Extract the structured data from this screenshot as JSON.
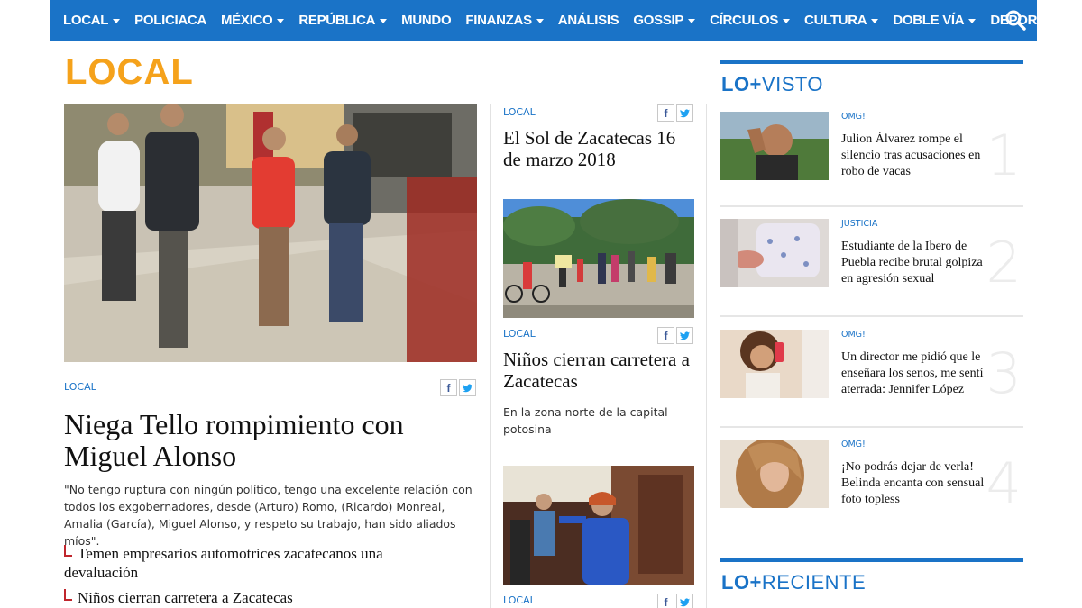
{
  "nav": {
    "items": [
      {
        "label": "LOCAL",
        "dropdown": true
      },
      {
        "label": "POLICIACA",
        "dropdown": false
      },
      {
        "label": "MÉXICO",
        "dropdown": true
      },
      {
        "label": "REPÚBLICA",
        "dropdown": true
      },
      {
        "label": "MUNDO",
        "dropdown": false
      },
      {
        "label": "FINANZAS",
        "dropdown": true
      },
      {
        "label": "ANÁLISIS",
        "dropdown": false
      },
      {
        "label": "GOSSIP",
        "dropdown": true
      },
      {
        "label": "CÍRCULOS",
        "dropdown": true
      },
      {
        "label": "CULTURA",
        "dropdown": true
      },
      {
        "label": "DOBLE VÍA",
        "dropdown": true
      },
      {
        "label": "DEPORTES",
        "dropdown": true
      }
    ],
    "search_icon": "search-icon",
    "color": "#1a73c7"
  },
  "section": {
    "title": "LOCAL",
    "color": "#f5a21b"
  },
  "main": {
    "category": "LOCAL",
    "headline": "Niega Tello rompimiento con Miguel Alonso",
    "summary": "\"No tengo ruptura con ningún político, tengo una excelente relación con todos los exgobernadores, desde (Arturo) Romo, (Ricardo) Monreal, Amalia (García), Miguel Alonso, y respeto su trabajo, han sido aliados míos\".",
    "related": [
      "Temen empresarios automotrices zacatecanos una devaluación",
      "Niños cierran carretera a Zacatecas"
    ]
  },
  "middle": {
    "story1": {
      "category": "LOCAL",
      "headline": "El Sol de Zacatecas 16 de marzo 2018"
    },
    "story2": {
      "category": "LOCAL",
      "headline": "Niños cierran carretera a Zacatecas",
      "summary": "En la zona norte de la capital potosina"
    },
    "story3": {
      "category": "LOCAL"
    }
  },
  "share": {
    "facebook": "f",
    "twitter": "twitter-icon"
  },
  "sidebar": {
    "most_viewed": {
      "prefix": "LO+",
      "suffix": "VISTO"
    },
    "items": [
      {
        "category": "OMG!",
        "text": "Julion Álvarez rompe el silencio tras acusaciones en robo de vacas",
        "rank": "1"
      },
      {
        "category": "JUSTICIA",
        "text": "Estudiante de la Ibero de Puebla recibe brutal golpiza en agresión sexual",
        "rank": "2"
      },
      {
        "category": "OMG!",
        "text": "Un director me pidió que le enseñara los senos, me sentí aterrada: Jennifer López",
        "rank": "3"
      },
      {
        "category": "OMG!",
        "text": "¡No podrás dejar de verla! Belinda encanta con sensual foto topless",
        "rank": "4"
      }
    ],
    "recent": {
      "prefix": "LO+",
      "suffix": "RECIENTE"
    }
  }
}
